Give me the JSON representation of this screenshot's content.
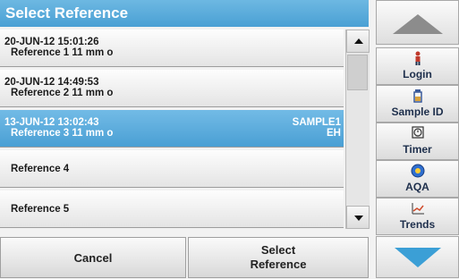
{
  "title": "Select Reference",
  "references": [
    {
      "date_time": "20-JUN-12  15:01:26",
      "name": "Reference 1  11 mm o",
      "sample": "",
      "extra": "",
      "selected": false
    },
    {
      "date_time": "20-JUN-12  14:49:53",
      "name": "Reference 2  11 mm o",
      "sample": "",
      "extra": "",
      "selected": false
    },
    {
      "date_time": "13-JUN-12  13:02:43",
      "name": "Reference 3  11 mm o",
      "sample": "SAMPLE1",
      "extra": "EH",
      "selected": true
    },
    {
      "date_time": "",
      "name": "Reference 4",
      "sample": "",
      "extra": "",
      "selected": false
    },
    {
      "date_time": "",
      "name": "Reference 5",
      "sample": "",
      "extra": "",
      "selected": false
    }
  ],
  "buttons": {
    "cancel": "Cancel",
    "select_line1": "Select",
    "select_line2": "Reference"
  },
  "side_tools": [
    {
      "label": "Login",
      "icon": "person-icon",
      "color": "#c0392b"
    },
    {
      "label": "Sample ID",
      "icon": "sample-bottle-icon",
      "color": "#3a5a9a"
    },
    {
      "label": "Timer",
      "icon": "timer-icon",
      "color": "#333333"
    },
    {
      "label": "AQA",
      "icon": "aqa-globe-icon",
      "color": "#2f6fd0"
    },
    {
      "label": "Trends",
      "icon": "trend-chart-icon",
      "color": "#d04a2a"
    }
  ],
  "colors": {
    "accent": "#4aa0d4",
    "title_bar": "#5aaedc",
    "nav_arrow_down": "#3b9fd6"
  }
}
